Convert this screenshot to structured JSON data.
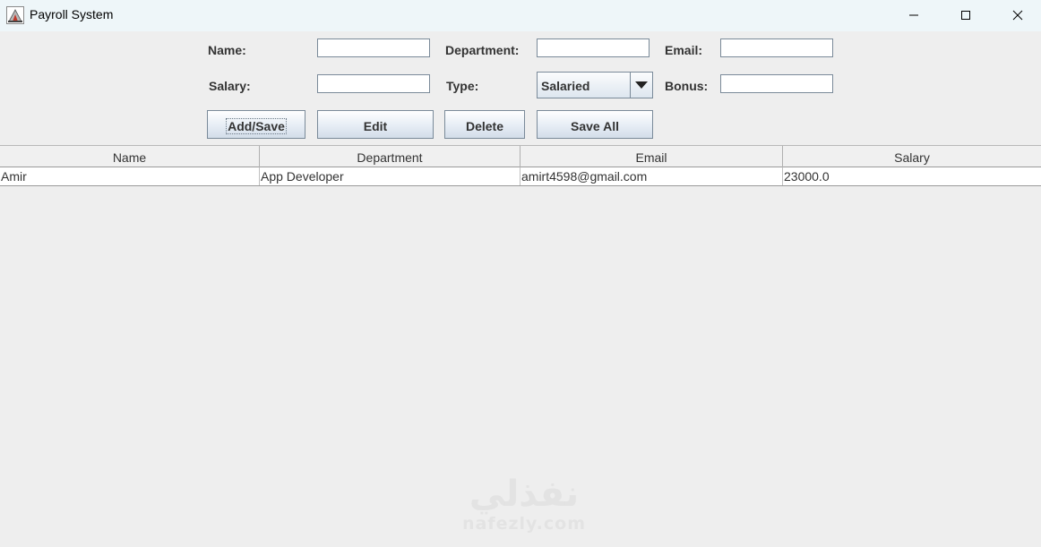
{
  "window": {
    "title": "Payroll System"
  },
  "form": {
    "name_label": "Name:",
    "department_label": "Department:",
    "email_label": "Email:",
    "salary_label": "Salary:",
    "type_label": "Type:",
    "bonus_label": "Bonus:",
    "name_value": "",
    "department_value": "",
    "email_value": "",
    "salary_value": "",
    "bonus_value": "",
    "type_selected": "Salaried"
  },
  "buttons": {
    "add_save": "Add/Save",
    "edit": "Edit",
    "delete": "Delete",
    "save_all": "Save All"
  },
  "table": {
    "columns": [
      "Name",
      "Department",
      "Email",
      "Salary"
    ],
    "rows": [
      [
        "Amir",
        "App Developer",
        "amirt4598@gmail.com",
        "23000.0"
      ]
    ]
  },
  "watermark": {
    "arabic": "نفذلي",
    "latin": "nafezly.com"
  },
  "icons": {
    "app": "java-icon",
    "minimize": "minimize-icon",
    "maximize": "maximize-icon",
    "close": "close-icon",
    "dropdown": "chevron-down-icon"
  }
}
